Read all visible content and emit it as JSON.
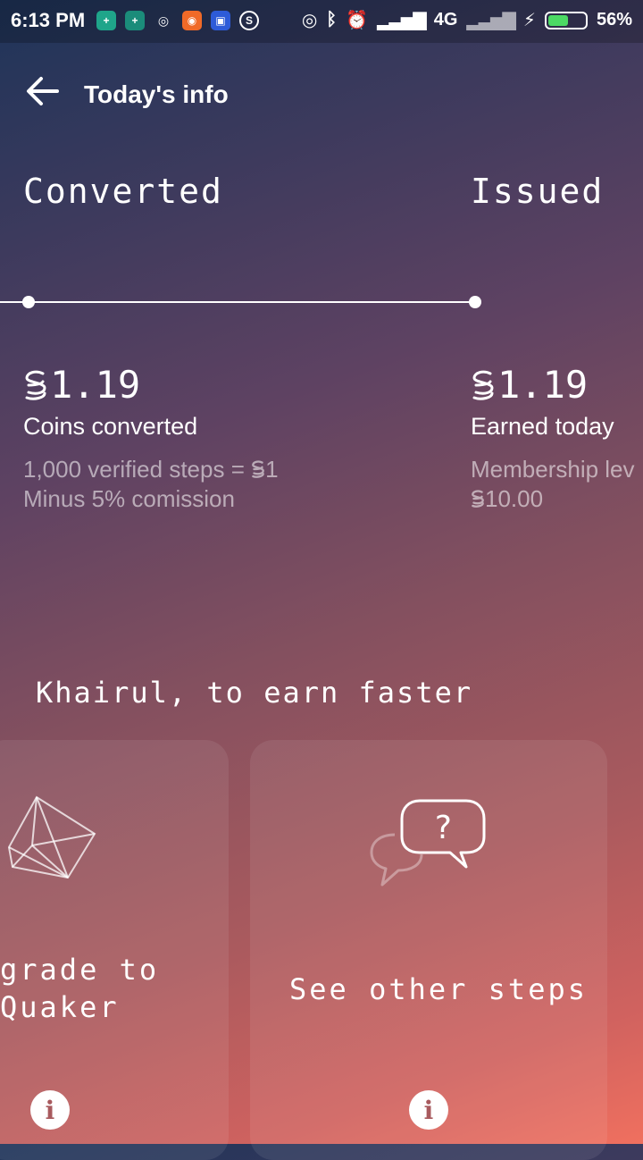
{
  "status_bar": {
    "time": "6:13 PM",
    "network": "4G",
    "battery": "56%",
    "battery_level": 0.56
  },
  "header": {
    "title": "Today's info"
  },
  "columns": [
    {
      "heading": "Converted",
      "amount": "1.19",
      "label": "Coins converted",
      "sub": [
        "1,000 verified steps = ",
        "1"
      ],
      "sub2": "Minus 5% comission"
    },
    {
      "heading": "Issued",
      "amount": "1.19",
      "label": "Earned today",
      "sub": "Membership lev",
      "sub2": "10.00"
    }
  ],
  "earn_section": {
    "title": "Khairul, to earn faster"
  },
  "cards": [
    {
      "line1": "grade to",
      "line2": "Quaker",
      "info_icon": "i"
    },
    {
      "line1": "See other steps",
      "info_icon": "i"
    }
  ],
  "colors": {
    "battery": "#4cd964"
  }
}
